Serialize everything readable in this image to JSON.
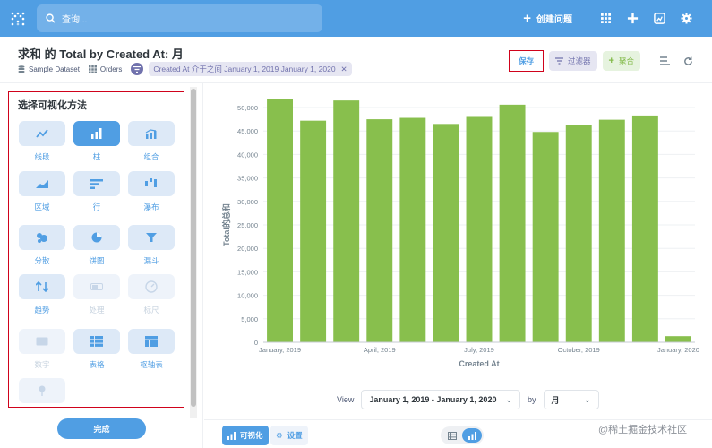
{
  "topbar": {
    "search_placeholder": "查询...",
    "new_question_label": "创建问题",
    "accent_color": "#509ee3"
  },
  "header": {
    "title": "求和 的 Total by Created At: 月",
    "database": "Sample Dataset",
    "table": "Orders",
    "filter_pill": "Created At 介于之间 January 1, 2019 January 1, 2020",
    "save_label": "保存",
    "filter_label": "过滤器",
    "summarize_label": "聚合"
  },
  "sidebar": {
    "title": "选择可视化方法",
    "items": [
      {
        "label": "线段",
        "icon": "line-icon",
        "state": "normal"
      },
      {
        "label": "柱",
        "icon": "bar-icon",
        "state": "selected"
      },
      {
        "label": "组合",
        "icon": "combo-icon",
        "state": "normal"
      },
      {
        "label": "区域",
        "icon": "area-icon",
        "state": "normal"
      },
      {
        "label": "行",
        "icon": "row-icon",
        "state": "normal"
      },
      {
        "label": "瀑布",
        "icon": "waterfall-icon",
        "state": "normal"
      },
      {
        "label": "分散",
        "icon": "scatter-icon",
        "state": "normal"
      },
      {
        "label": "饼图",
        "icon": "pie-icon",
        "state": "normal"
      },
      {
        "label": "漏斗",
        "icon": "funnel-icon",
        "state": "normal"
      },
      {
        "label": "趋势",
        "icon": "trend-icon",
        "state": "normal"
      },
      {
        "label": "处理",
        "icon": "progress-icon",
        "state": "disabled"
      },
      {
        "label": "标尺",
        "icon": "gauge-icon",
        "state": "disabled"
      },
      {
        "label": "数字",
        "icon": "number-icon",
        "state": "disabled"
      },
      {
        "label": "表格",
        "icon": "table-icon",
        "state": "normal"
      },
      {
        "label": "枢轴表",
        "icon": "pivot-icon",
        "state": "normal"
      },
      {
        "label": "",
        "icon": "map-pin-icon",
        "state": "disabled"
      }
    ],
    "done_label": "完成"
  },
  "viewbar": {
    "view_label": "View",
    "range_value": "January 1, 2019 - January 1, 2020",
    "by_label": "by",
    "unit_value": "月"
  },
  "bottombar": {
    "visualize_label": "可视化",
    "settings_label": "设置"
  },
  "watermark": "@稀土掘金技术社区",
  "chart_data": {
    "type": "bar",
    "categories": [
      "January, 2019",
      "February, 2019",
      "March, 2019",
      "April, 2019",
      "May, 2019",
      "June, 2019",
      "July, 2019",
      "August, 2019",
      "September, 2019",
      "October, 2019",
      "November, 2019",
      "December, 2019",
      "January, 2020"
    ],
    "x_tick_labels": [
      "January, 2019",
      "April, 2019",
      "July, 2019",
      "October, 2019",
      "January, 2020"
    ],
    "x_tick_indices": [
      0,
      3,
      6,
      9,
      12
    ],
    "values": [
      51800,
      47200,
      51500,
      47500,
      47800,
      46500,
      48000,
      50600,
      44800,
      46300,
      47400,
      48300,
      1300
    ],
    "xlabel": "Created At",
    "ylabel": "Total的总和",
    "ylim": [
      0,
      50000
    ],
    "ytick_values": [
      0,
      5000,
      10000,
      15000,
      20000,
      25000,
      30000,
      35000,
      40000,
      45000,
      50000
    ],
    "ytick_labels": [
      "0",
      "5,000",
      "10,000",
      "15,000",
      "20,000",
      "25,000",
      "30,000",
      "35,000",
      "40,000",
      "45,000",
      "50,000"
    ],
    "bar_color": "#88bf4d",
    "grid": true
  }
}
